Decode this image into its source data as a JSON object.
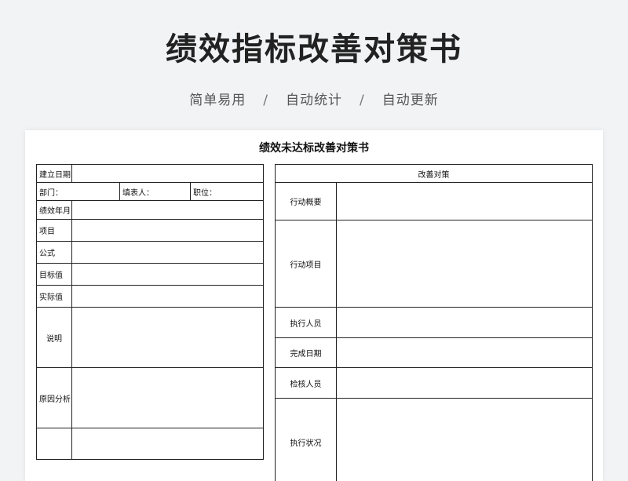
{
  "header": {
    "title": "绩效指标改善对策书",
    "features": [
      "简单易用",
      "自动统计",
      "自动更新"
    ],
    "separator": "/"
  },
  "document": {
    "title": "绩效未达标改善对策书",
    "left_rows": {
      "date": "建立日期",
      "department": "部门：",
      "filler": "填表人：",
      "position": "职位：",
      "month": "绩效年月",
      "item": "项目",
      "formula": "公式",
      "target": "目标值",
      "actual": "实际值",
      "description": "说明",
      "cause": "原因分析"
    },
    "right_table": {
      "header": "改善对策",
      "rows": [
        "行动概要",
        "行动项目",
        "执行人员",
        "完成日期",
        "检核人员",
        "执行状况"
      ]
    }
  }
}
